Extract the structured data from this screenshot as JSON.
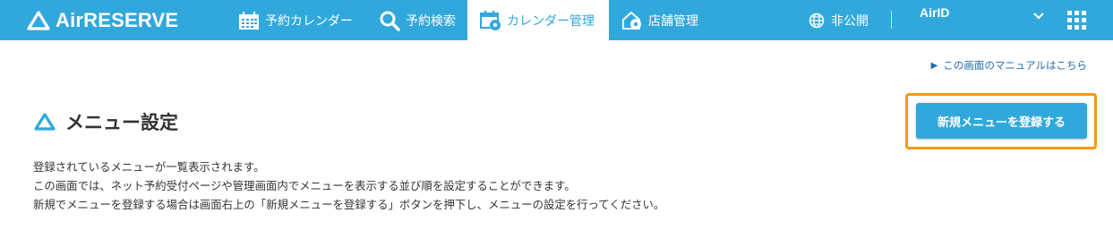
{
  "header": {
    "logo_text": "AirRESERVE",
    "nav": [
      {
        "label": "予約カレンダー",
        "icon": "calendar-icon",
        "active": false
      },
      {
        "label": "予約検索",
        "icon": "search-icon",
        "active": false
      },
      {
        "label": "カレンダー管理",
        "icon": "calendar-gear-icon",
        "active": true
      },
      {
        "label": "店舗管理",
        "icon": "store-gear-icon",
        "active": false
      }
    ],
    "publish_label": "非公開",
    "account_label": "AirID"
  },
  "manual_link": "この画面のマニュアルはこちら",
  "page": {
    "title": "メニュー設定",
    "register_button": "新規メニューを登録する",
    "description": [
      "登録されているメニューが一覧表示されます。",
      "この画面では、ネット予約受付ページや管理画面内でメニューを表示する並び順を設定することができます。",
      "新規でメニューを登録する場合は画面右上の「新規メニューを登録する」ボタンを押下し、メニューの設定を行ってください。"
    ]
  },
  "colors": {
    "brand": "#31a8dc",
    "highlight": "#f59a0c",
    "link": "#1f6db0"
  }
}
